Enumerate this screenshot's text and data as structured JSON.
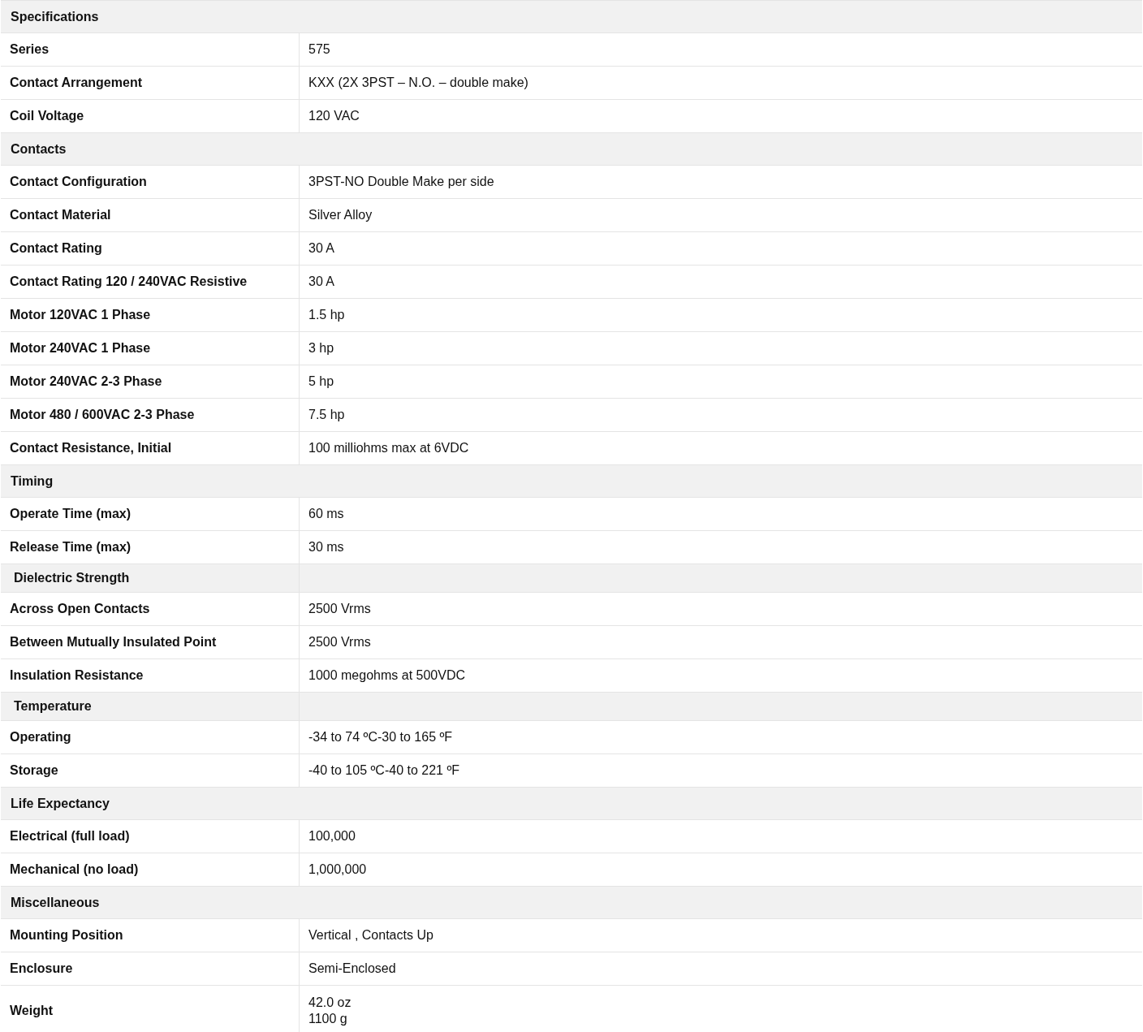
{
  "sections": [
    {
      "title": "Specifications",
      "kind": "full",
      "rows": [
        {
          "label": "Series",
          "value": "575"
        },
        {
          "label": "Contact Arrangement",
          "value": "KXX (2X 3PST – N.O. – double make)"
        },
        {
          "label": "Coil Voltage",
          "value": "120 VAC"
        }
      ]
    },
    {
      "title": "Contacts",
      "kind": "full",
      "rows": [
        {
          "label": "Contact Configuration",
          "value": "3PST-NO Double Make per side"
        },
        {
          "label": "Contact Material",
          "value": "Silver Alloy"
        },
        {
          "label": "Contact Rating",
          "value": "30 A"
        },
        {
          "label": "Contact Rating 120 / 240VAC Resistive",
          "value": "30 A"
        },
        {
          "label": "Motor 120VAC 1 Phase",
          "value": "1.5 hp"
        },
        {
          "label": "Motor 240VAC 1 Phase",
          "value": "3 hp"
        },
        {
          "label": "Motor 240VAC 2-3 Phase",
          "value": "5 hp"
        },
        {
          "label": "Motor 480 / 600VAC 2-3 Phase",
          "value": "7.5 hp"
        },
        {
          "label": "Contact Resistance, Initial",
          "value": "100 milliohms max at 6VDC"
        }
      ]
    },
    {
      "title": "Timing",
      "kind": "full",
      "rows": [
        {
          "label": "Operate Time (max)",
          "value": "60 ms"
        },
        {
          "label": "Release Time (max)",
          "value": "30 ms"
        }
      ]
    },
    {
      "title": "Dielectric Strength",
      "kind": "split",
      "rows": [
        {
          "label": "Across Open Contacts",
          "value": "2500 Vrms"
        },
        {
          "label": "Between Mutually Insulated Point",
          "value": "2500 Vrms"
        },
        {
          "label": "Insulation Resistance",
          "value": "1000 megohms at 500VDC"
        }
      ]
    },
    {
      "title": "Temperature",
      "kind": "split",
      "rows": [
        {
          "label": "Operating",
          "value": "-34 to 74 ºC-30 to 165 ºF"
        },
        {
          "label": "Storage",
          "value": "-40 to 105 ºC-40 to 221 ºF"
        }
      ]
    },
    {
      "title": "Life Expectancy",
      "kind": "full",
      "rows": [
        {
          "label": "Electrical (full load)",
          "value": "100,000"
        },
        {
          "label": "Mechanical (no load)",
          "value": "1,000,000"
        }
      ]
    },
    {
      "title": "Miscellaneous",
      "kind": "full",
      "rows": [
        {
          "label": "Mounting Position",
          "value": "Vertical , Contacts Up"
        },
        {
          "label": "Enclosure",
          "value": "Semi-Enclosed"
        },
        {
          "label": "Weight",
          "value": "42.0 oz\n1100 g"
        }
      ]
    }
  ]
}
